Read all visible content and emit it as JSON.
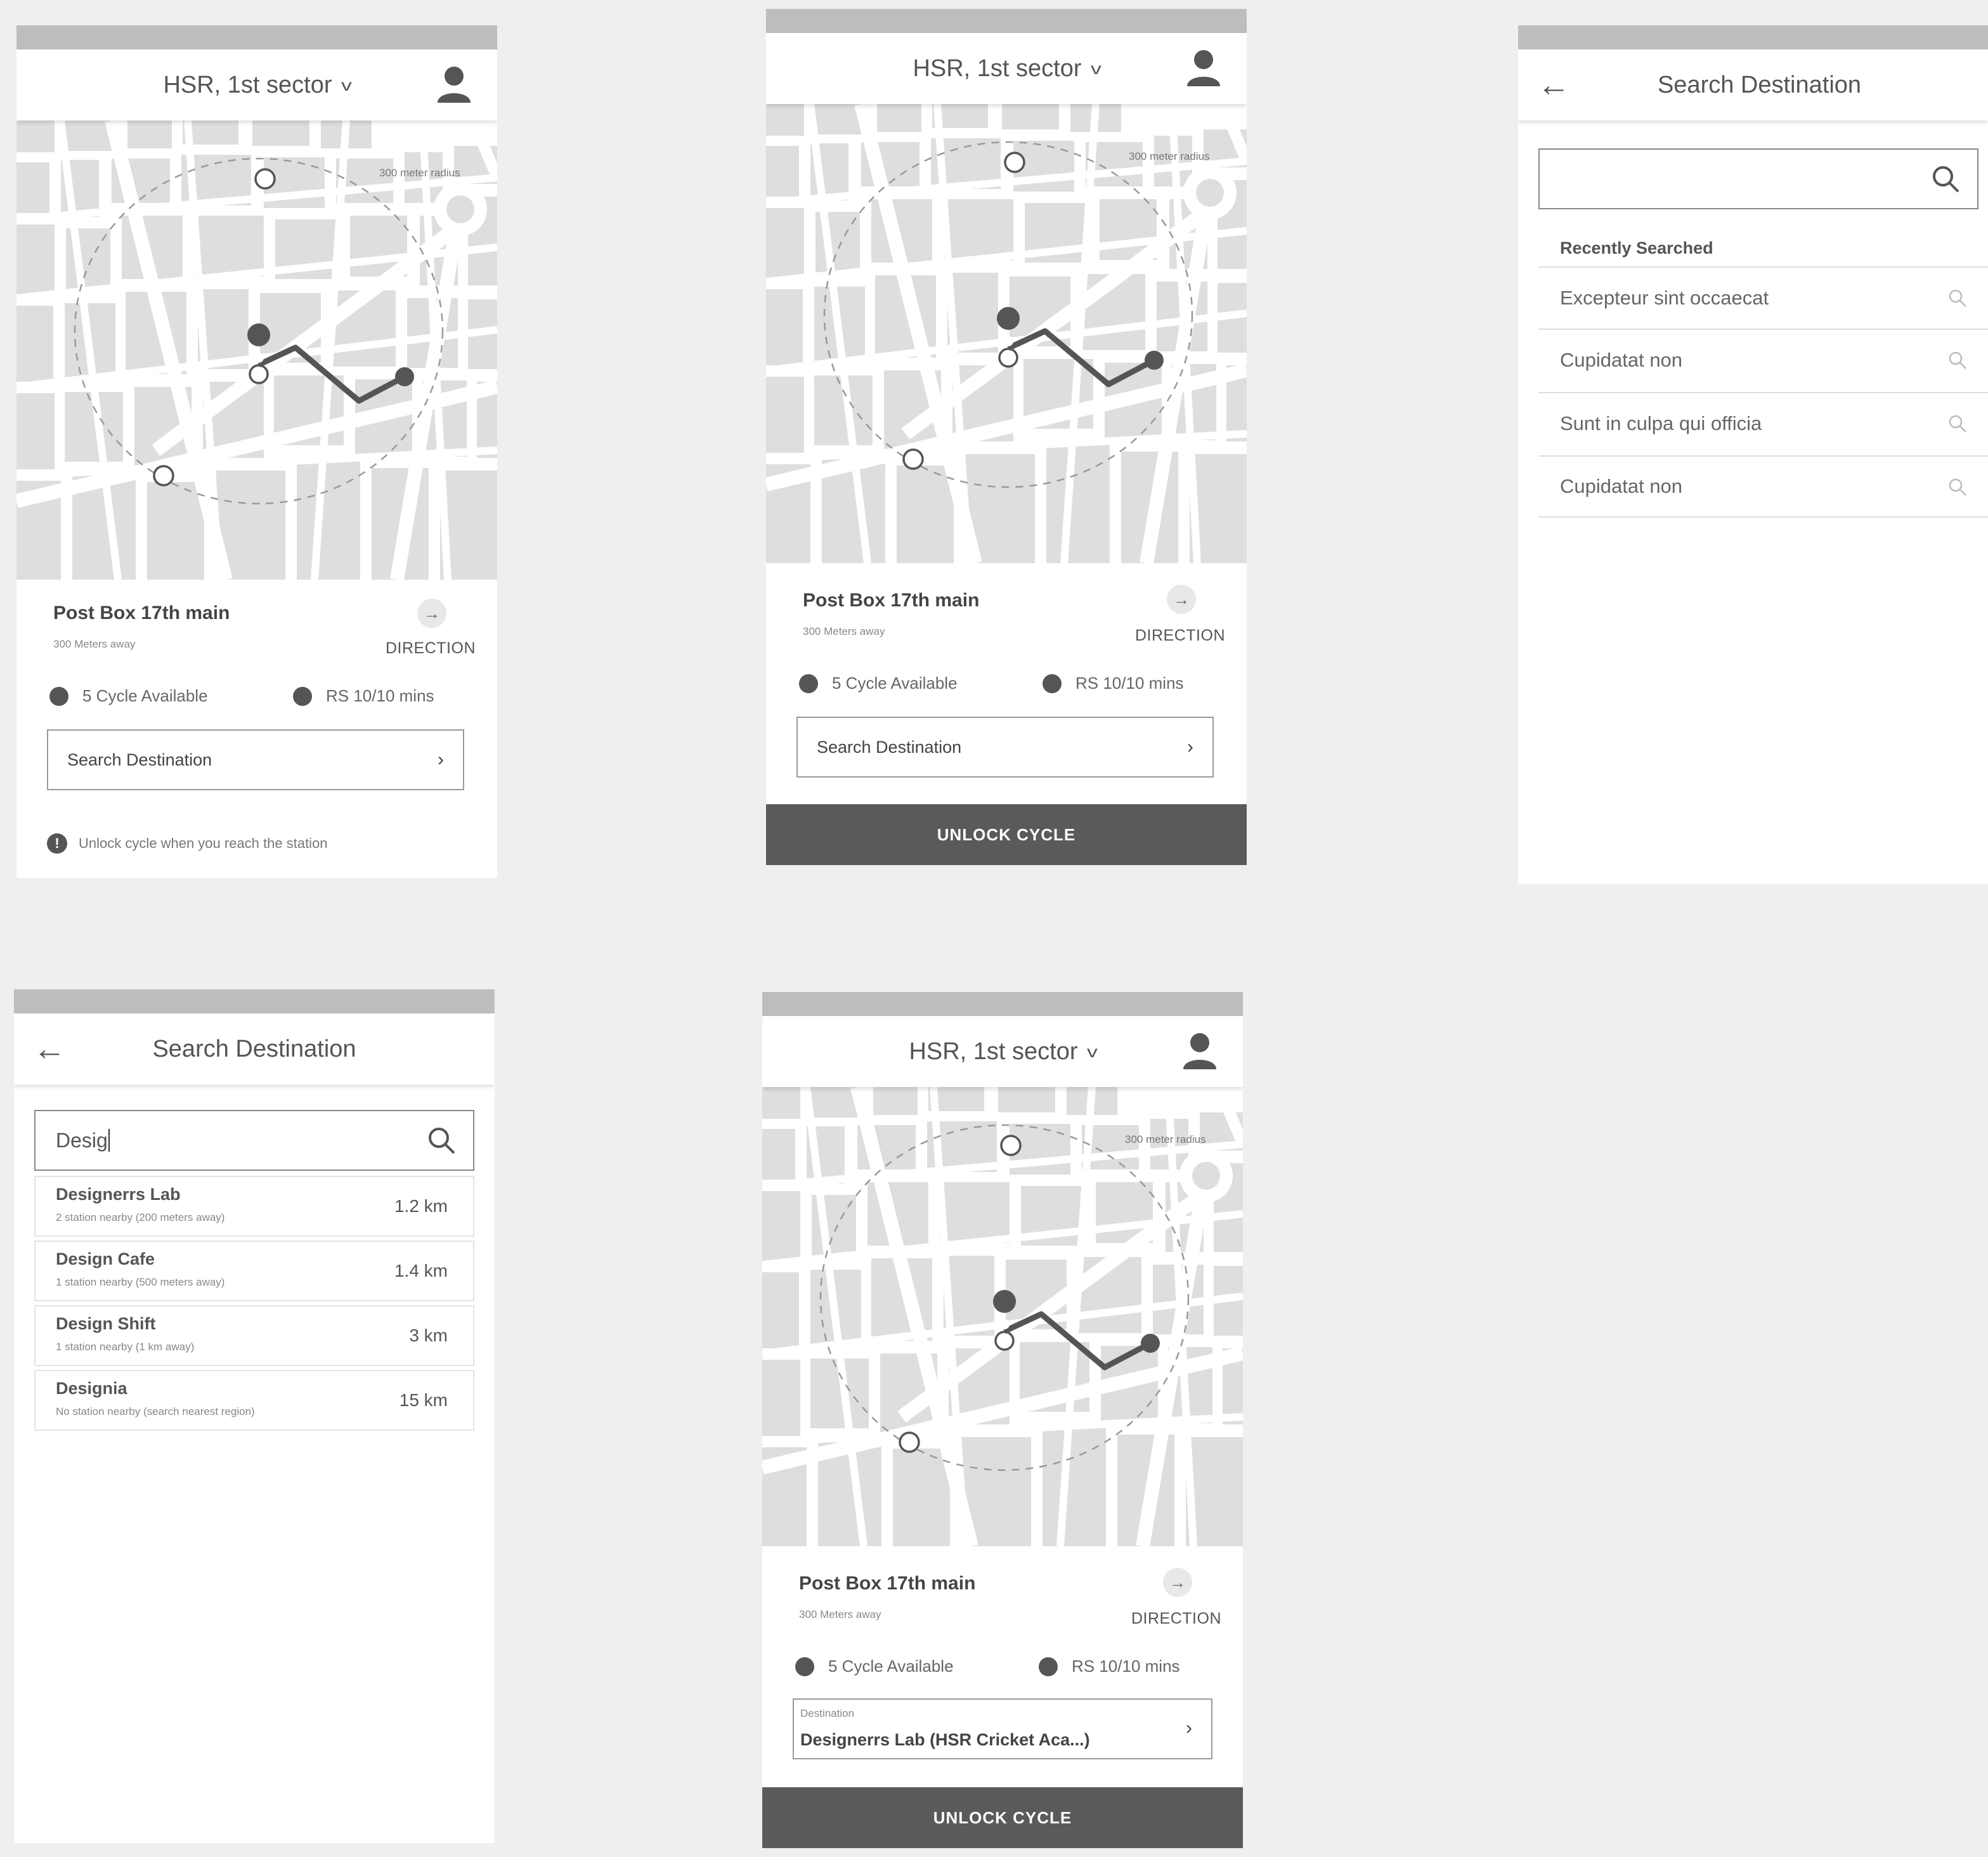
{
  "header": {
    "location": "HSR, 1st sector"
  },
  "map": {
    "radius_label": "300 meter radius"
  },
  "station": {
    "name": "Post Box 17th main",
    "distance": "300 Meters away",
    "direction_label": "DIRECTION",
    "cycles": "5 Cycle Available",
    "rate": "RS 10/10 mins"
  },
  "search_button": {
    "label": "Search Destination"
  },
  "notice": "Unlock cycle when you reach the station",
  "unlock_label": "UNLOCK CYCLE",
  "search_screen": {
    "title": "Search Destination",
    "recent_header": "Recently Searched",
    "recent": [
      "Excepteur sint occaecat",
      "Cupidatat non",
      "Sunt in culpa qui officia",
      "Cupidatat non"
    ]
  },
  "results_screen": {
    "title": "Search Destination",
    "query": "Desig",
    "results": [
      {
        "name": "Designerrs Lab",
        "sub": "2 station nearby (200 meters away)",
        "dist": "1.2 km"
      },
      {
        "name": "Design Cafe",
        "sub": "1 station nearby (500 meters away)",
        "dist": "1.4 km"
      },
      {
        "name": "Design Shift",
        "sub": "1 station nearby (1 km away)",
        "dist": "3 km"
      },
      {
        "name": "Designia",
        "sub": "No station nearby (search nearest region)",
        "dist": "15 km"
      }
    ]
  },
  "destination": {
    "label": "Destination",
    "value": "Designerrs Lab (HSR Cricket Aca...)"
  },
  "icons": [
    "user-icon",
    "chevron-down-icon",
    "arrow-right-icon",
    "back-arrow-icon",
    "search-icon",
    "alert-icon",
    "chevron-right-icon"
  ],
  "colors": {
    "background": "#efefef",
    "status_bar": "#bdbdbd",
    "button_dark": "#5a5a5a",
    "map_block": "#dedede",
    "route": "#555555"
  }
}
